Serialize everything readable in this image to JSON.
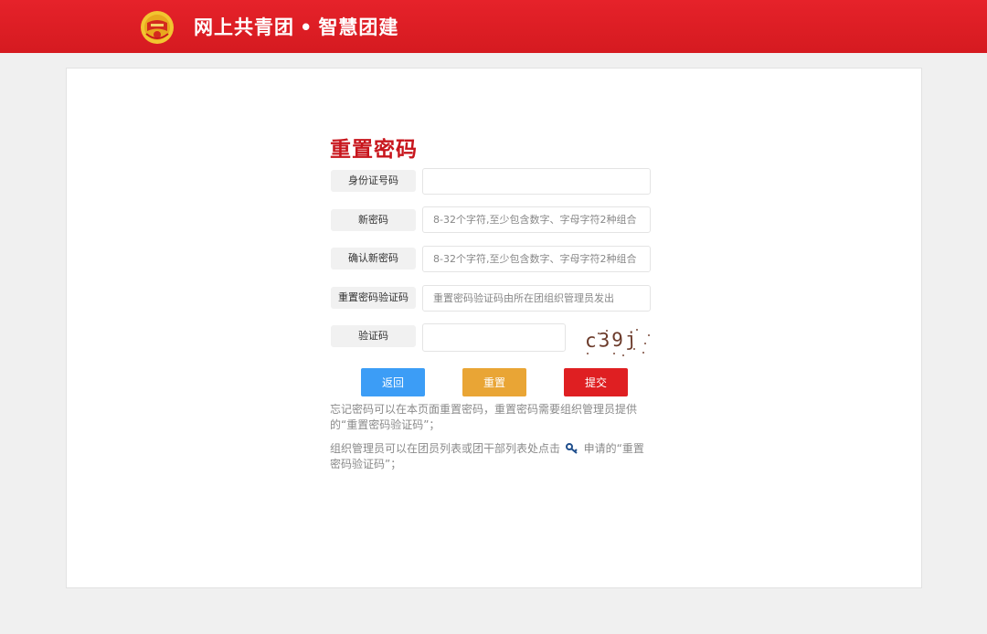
{
  "header": {
    "brand_left": "网上共青团",
    "separator": "•",
    "brand_right": "智慧团建",
    "logo_icon": "youth-league-emblem-icon"
  },
  "form": {
    "title": "重置密码",
    "fields": [
      {
        "label": "身份证号码",
        "value": "",
        "placeholder": ""
      },
      {
        "label": "新密码",
        "value": "",
        "placeholder": "8-32个字符,至少包含数字、字母字符2种组合"
      },
      {
        "label": "确认新密码",
        "value": "",
        "placeholder": "8-32个字符,至少包含数字、字母字符2种组合"
      },
      {
        "label": "重置密码验证码",
        "value": "",
        "placeholder": "重置密码验证码由所在团组织管理员发出"
      },
      {
        "label": "验证码",
        "value": "",
        "placeholder": ""
      }
    ],
    "captcha_text": "c39j",
    "buttons": {
      "back": "返回",
      "reset": "重置",
      "submit": "提交"
    }
  },
  "notes": {
    "line1": "忘记密码可以在本页面重置密码，重置密码需要组织管理员提供的“重置密码验证码”；",
    "line2_before": "组织管理员可以在团员列表或团干部列表处点击",
    "line2_icon": "key-icon",
    "line2_after": "申请的“重置密码验证码”；"
  },
  "colors": {
    "header_red": "#e6222a",
    "title_red": "#c8161d",
    "back_blue": "#3c9df6",
    "reset_orange": "#e9a535",
    "submit_red": "#df1f22"
  }
}
